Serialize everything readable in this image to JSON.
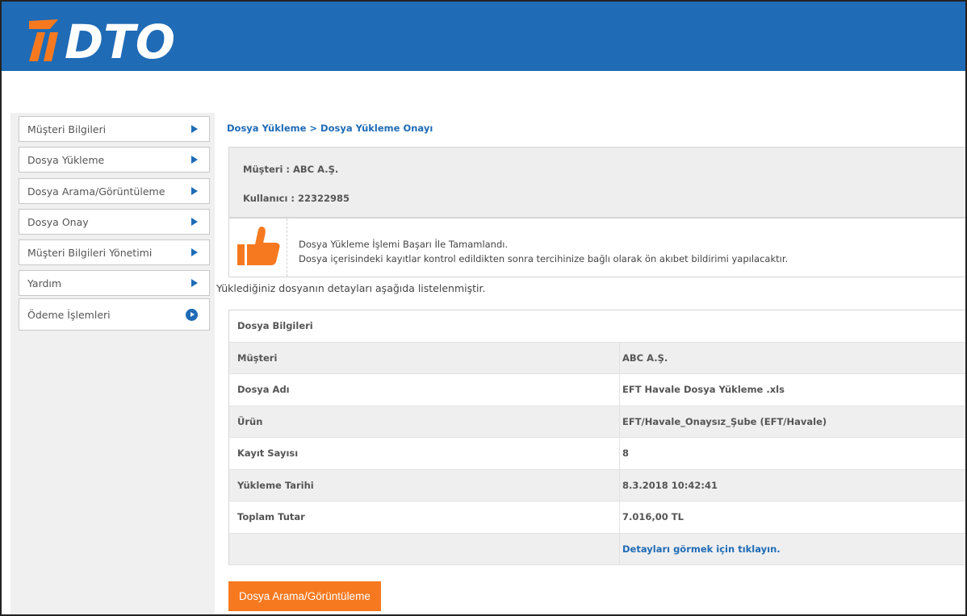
{
  "header": {
    "logo_text": "DTO",
    "brand_blue": "#1f6bb6",
    "brand_orange": "#f7791f"
  },
  "sidebar": {
    "items": [
      {
        "label": "Müşteri Bilgileri",
        "icon": "arrow-right-icon"
      },
      {
        "label": "Dosya Yükleme",
        "icon": "arrow-right-icon"
      },
      {
        "label": "Dosya Arama/Görüntüleme",
        "icon": "arrow-right-icon"
      },
      {
        "label": "Dosya Onay",
        "icon": "arrow-right-icon"
      },
      {
        "label": "Müşteri Bilgileri Yönetimi",
        "icon": "arrow-right-icon"
      },
      {
        "label": "Yardım",
        "icon": "arrow-right-icon"
      },
      {
        "label": "Ödeme İşlemleri",
        "icon": "circle-arrow-icon"
      }
    ]
  },
  "main": {
    "breadcrumb": "Dosya Yükleme > Dosya Yükleme Onayı",
    "customer_line": "Müşteri :  ABC A.Ş.",
    "user_line": "Kullanıcı : 22322985",
    "success_title": "Dosya Yükleme İşlemi Başarı İle Tamamlandı.",
    "success_desc": "Dosya içerisindeki kayıtlar kontrol edildikten sonra tercihinize bağlı olarak ön akıbet bildirimi yapılacaktır.",
    "details_note": "Yüklediğiniz dosyanın detayları aşağıda listelenmiştir.",
    "table": {
      "title": "Dosya Bilgileri",
      "rows": [
        {
          "label": "Müşteri",
          "value": "ABC A.Ş."
        },
        {
          "label": "Dosya Adı",
          "value": "EFT Havale Dosya Yükleme .xls"
        },
        {
          "label": "Ürün",
          "value": "EFT/Havale_Onaysız_Şube (EFT/Havale)"
        },
        {
          "label": "Kayıt Sayısı",
          "value": "8"
        },
        {
          "label": "Yükleme Tarihi",
          "value": "8.3.2018 10:42:41"
        },
        {
          "label": "Toplam Tutar",
          "value": "7.016,00 TL"
        }
      ],
      "details_link": "Detayları görmek için tıklayın."
    },
    "search_button": "Dosya Arama/Görüntüleme"
  }
}
